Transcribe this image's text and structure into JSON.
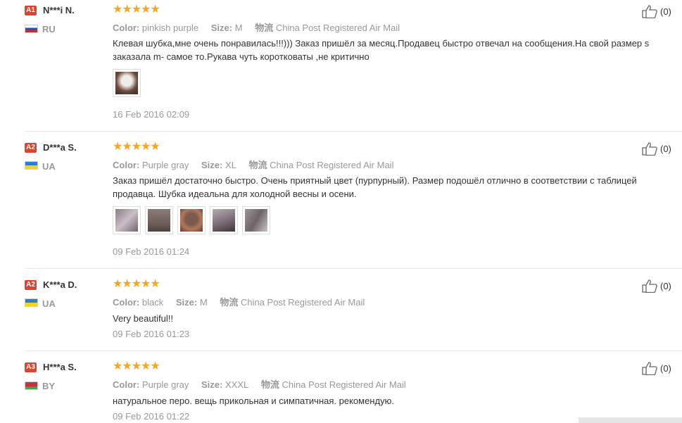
{
  "colors": {
    "star": "#f6a623",
    "badge_a1": "#d9452e",
    "badge_a2": "#d9452e",
    "badge_a3": "#d9452e"
  },
  "reviews": [
    {
      "badge": "A1",
      "name": "N***i N.",
      "country": "RU",
      "stars": "★★★★★",
      "color_label": "Color:",
      "color_value": "pinkish purple",
      "size_label": "Size:",
      "size_value": "M",
      "ship_label": "物流",
      "ship_value": "China Post Registered Air Mail",
      "text": "Клевая шубка,мне очень понравилась!!!))) Заказ пришёл за месяц.Продавец быстро отвечал на сообщения.На свой размер s заказала m- самое то.Рукава чуть коротковаты ,не критично",
      "date": "16 Feb 2016 02:09",
      "likes": "(0)",
      "thumb_count": 1
    },
    {
      "badge": "A2",
      "name": "D***a S.",
      "country": "UA",
      "stars": "★★★★★",
      "color_label": "Color:",
      "color_value": "Purple gray",
      "size_label": "Size:",
      "size_value": "XL",
      "ship_label": "物流",
      "ship_value": "China Post Registered Air Mail",
      "text": "Заказ пришёл достаточно быстро. Очень приятный цвет (пурпурный). Размер подошёл отлично в соответствии с таблицей продавца. Шубка идеальна для холодной весны и осени.",
      "date": "09 Feb 2016 01:24",
      "likes": "(0)",
      "thumb_count": 5
    },
    {
      "badge": "A2",
      "name": "K***a D.",
      "country": "UA",
      "stars": "★★★★★",
      "color_label": "Color:",
      "color_value": "black",
      "size_label": "Size:",
      "size_value": "M",
      "ship_label": "物流",
      "ship_value": "China Post Registered Air Mail",
      "text": "Very beautiful!!",
      "date": "09 Feb 2016 01:23",
      "likes": "(0)",
      "thumb_count": 0
    },
    {
      "badge": "A3",
      "name": "H***a S.",
      "country": "BY",
      "stars": "★★★★★",
      "color_label": "Color:",
      "color_value": "Purple gray",
      "size_label": "Size:",
      "size_value": "XXXL",
      "ship_label": "物流",
      "ship_value": "China Post Registered Air Mail",
      "text": "натуральное перо. вещь прикольная и симпатичная. рекомендую.",
      "date": "09 Feb 2016 01:22",
      "likes": "(0)",
      "thumb_count": 0
    }
  ]
}
